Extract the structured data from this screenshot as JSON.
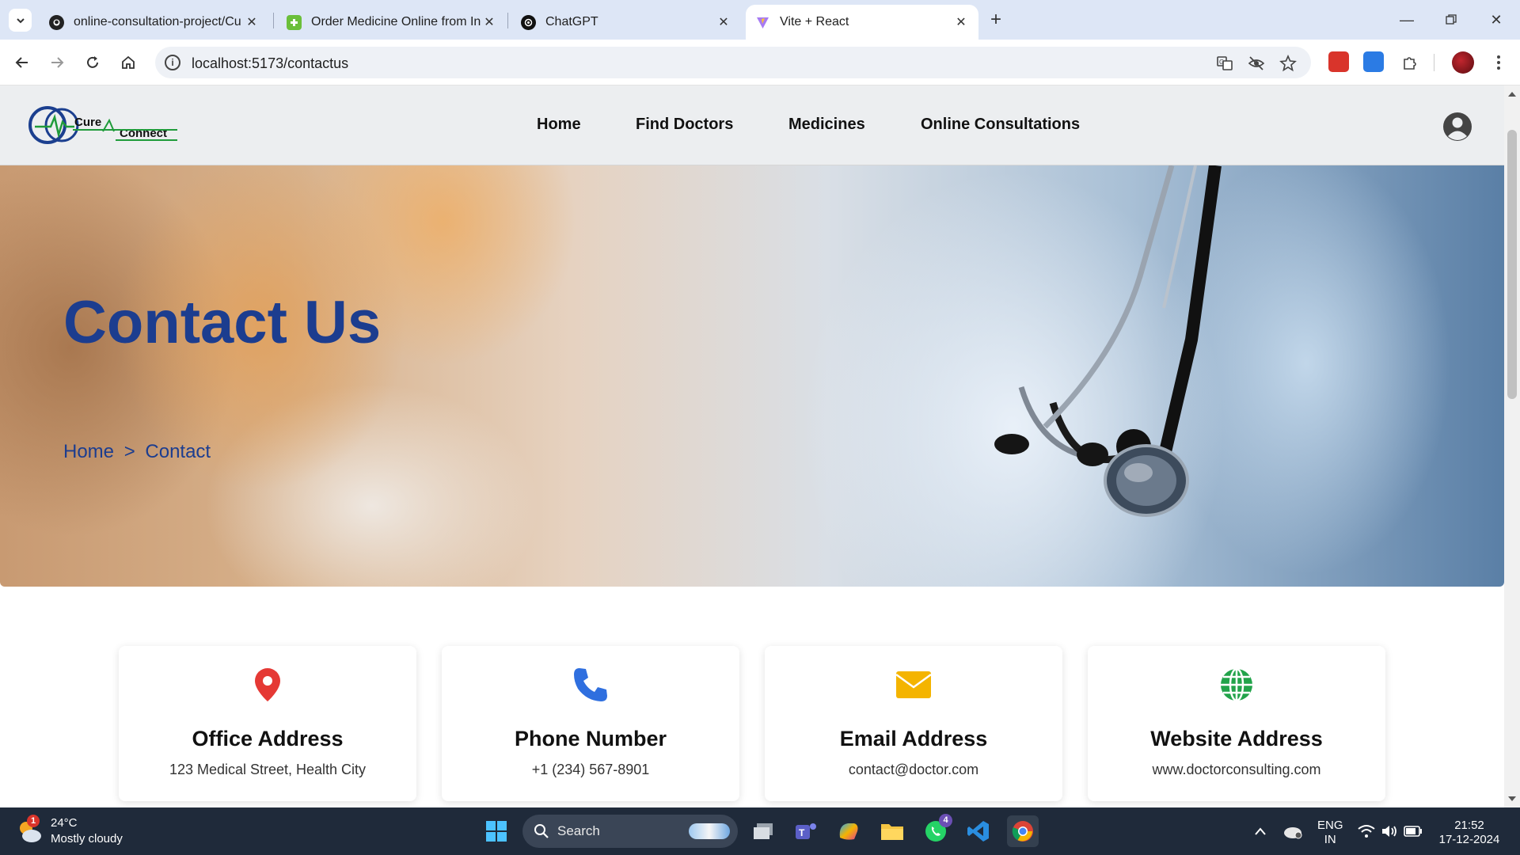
{
  "browser": {
    "tabs": [
      {
        "title": "online-consultation-project/Cu",
        "favicon": "github-icon",
        "active": false
      },
      {
        "title": "Order Medicine Online from Inc",
        "favicon": "pharmacy-icon",
        "active": false
      },
      {
        "title": "ChatGPT",
        "favicon": "chatgpt-icon",
        "active": false
      },
      {
        "title": "Vite + React",
        "favicon": "vite-icon",
        "active": true
      }
    ],
    "url": "localhost:5173/contactus"
  },
  "site": {
    "logo": {
      "word1": "Cure",
      "word2": "Connect"
    },
    "nav": [
      {
        "label": "Home"
      },
      {
        "label": "Find Doctors"
      },
      {
        "label": "Medicines"
      },
      {
        "label": "Online Consultations"
      }
    ],
    "hero": {
      "title": "Contact Us",
      "breadcrumb": {
        "home": "Home",
        "separator": ">",
        "current": "Contact"
      }
    },
    "cards": [
      {
        "icon": "location-pin-icon",
        "color": "#e53935",
        "title": "Office Address",
        "value": "123 Medical Street, Health City"
      },
      {
        "icon": "phone-icon",
        "color": "#2f6fdf",
        "title": "Phone Number",
        "value": "+1 (234) 567-8901"
      },
      {
        "icon": "envelope-icon",
        "color": "#f4b400",
        "title": "Email Address",
        "value": "contact@doctor.com"
      },
      {
        "icon": "globe-icon",
        "color": "#22a34a",
        "title": "Website Address",
        "value": "www.doctorconsulting.com"
      }
    ]
  },
  "taskbar": {
    "weather": {
      "temp": "24°C",
      "desc": "Mostly cloudy",
      "badge": "1"
    },
    "search_label": "Search",
    "whatsapp_badge": "4",
    "lang": {
      "line1": "ENG",
      "line2": "IN"
    },
    "clock": {
      "time": "21:52",
      "date": "17-12-2024"
    }
  }
}
